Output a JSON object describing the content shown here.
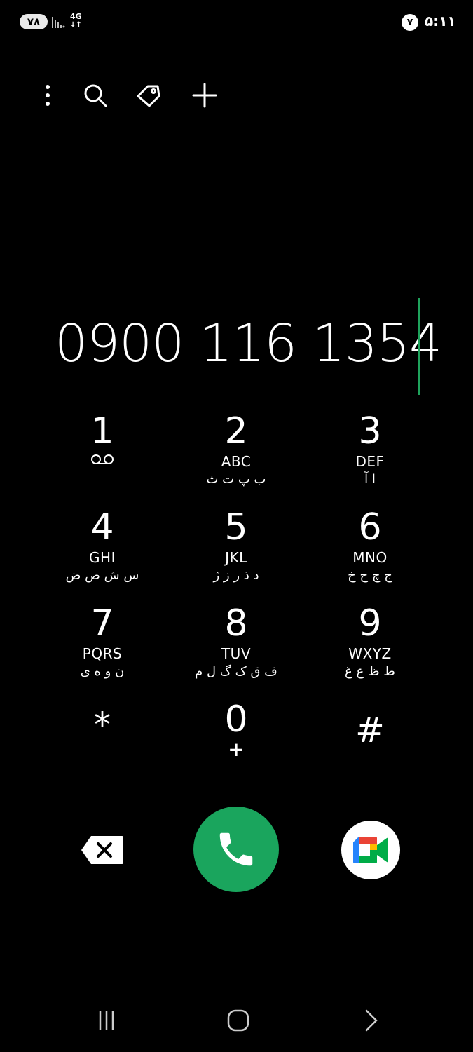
{
  "status_bar": {
    "battery": "۷۸",
    "network_type": "4G",
    "notification_count": "۷",
    "time": "۵:۱۱"
  },
  "toolbar": {
    "icons": [
      "more-options-icon",
      "search-icon",
      "tag-icon",
      "add-icon"
    ]
  },
  "dialer": {
    "number": "0900 116 1354"
  },
  "keypad": [
    {
      "digit": "1",
      "letters": "",
      "persian": "",
      "sub_icon": "voicemail-icon"
    },
    {
      "digit": "2",
      "letters": "ABC",
      "persian": "ب پ ت ث"
    },
    {
      "digit": "3",
      "letters": "DEF",
      "persian": "ا آ"
    },
    {
      "digit": "4",
      "letters": "GHI",
      "persian": "س ش ص ض"
    },
    {
      "digit": "5",
      "letters": "JKL",
      "persian": "د ذ ر ز ژ"
    },
    {
      "digit": "6",
      "letters": "MNO",
      "persian": "ج چ ح خ"
    },
    {
      "digit": "7",
      "letters": "PQRS",
      "persian": "ن و ه ی"
    },
    {
      "digit": "8",
      "letters": "TUV",
      "persian": "ف ق ک گ ل م"
    },
    {
      "digit": "9",
      "letters": "WXYZ",
      "persian": "ط ظ ع غ"
    },
    {
      "digit": "*",
      "letters": "",
      "persian": ""
    },
    {
      "digit": "0",
      "letters": "",
      "persian": "",
      "sub": "+"
    },
    {
      "digit": "#",
      "letters": "",
      "persian": ""
    }
  ],
  "actions": {
    "backspace_icon": "backspace-icon",
    "call_icon": "phone-icon",
    "video_icon": "google-meet-icon",
    "call_color": "#1aa55d",
    "cursor_color": "#1fa35c"
  },
  "nav": {
    "icons": [
      "recent-apps-icon",
      "home-icon",
      "back-icon"
    ]
  }
}
